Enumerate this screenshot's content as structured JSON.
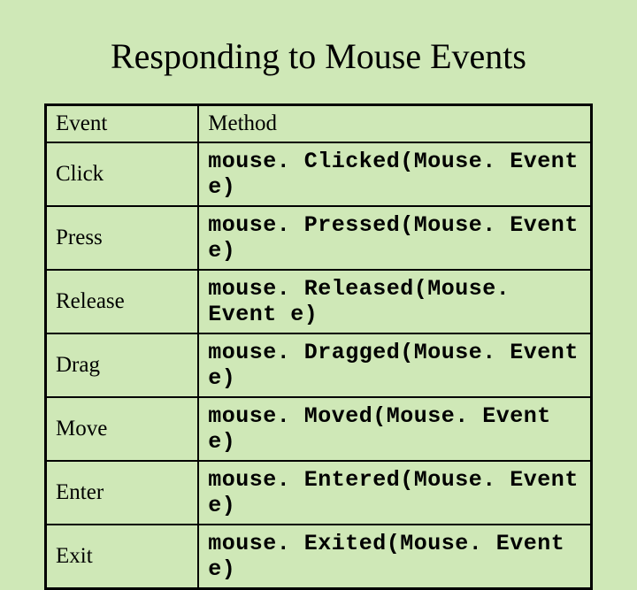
{
  "title": "Responding to Mouse Events",
  "headers": {
    "event": "Event",
    "method": "Method"
  },
  "rows": [
    {
      "event": "Click",
      "method": "mouse. Clicked(Mouse. Event e)"
    },
    {
      "event": "Press",
      "method": "mouse. Pressed(Mouse. Event e)"
    },
    {
      "event": "Release",
      "method": "mouse. Released(Mouse. Event e)"
    },
    {
      "event": "Drag",
      "method": "mouse. Dragged(Mouse. Event e)"
    },
    {
      "event": "Move",
      "method": "mouse. Moved(Mouse. Event e)"
    },
    {
      "event": "Enter",
      "method": "mouse. Entered(Mouse. Event e)"
    },
    {
      "event": "Exit",
      "method": "mouse. Exited(Mouse. Event e)"
    }
  ]
}
